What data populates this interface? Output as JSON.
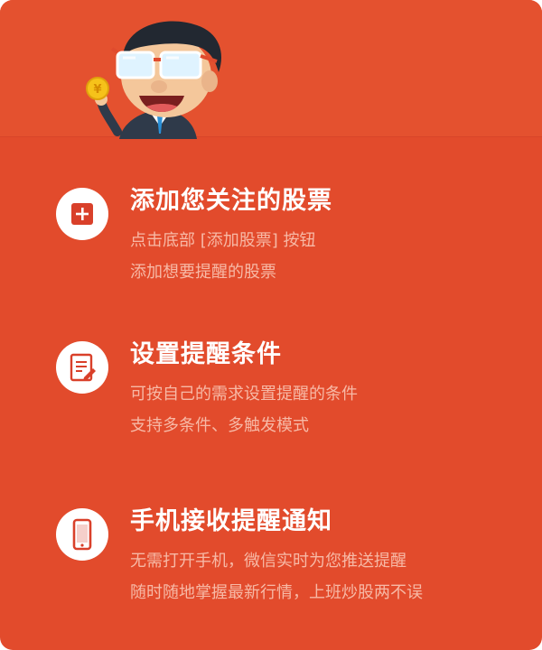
{
  "mascot": {
    "icon": "cartoon-man-with-glasses-holding-coin"
  },
  "features": [
    {
      "icon": "add-icon",
      "title": "添加您关注的股票",
      "line1": "点击底部 [添加股票] 按钮",
      "line2": "添加想要提醒的股票"
    },
    {
      "icon": "edit-list-icon",
      "title": "设置提醒条件",
      "line1": "可按自己的需求设置提醒的条件",
      "line2": "支持多条件、多触发模式"
    },
    {
      "icon": "phone-icon",
      "title": "手机接收提醒通知",
      "line1": "无需打开手机，微信实时为您推送提醒",
      "line2": "随时随地掌握最新行情，上班炒股两不误"
    }
  ],
  "colors": {
    "background": "#e24b2c",
    "accent": "#d9402a",
    "title": "#ffffff",
    "subtitle": "#f7b9a6"
  }
}
